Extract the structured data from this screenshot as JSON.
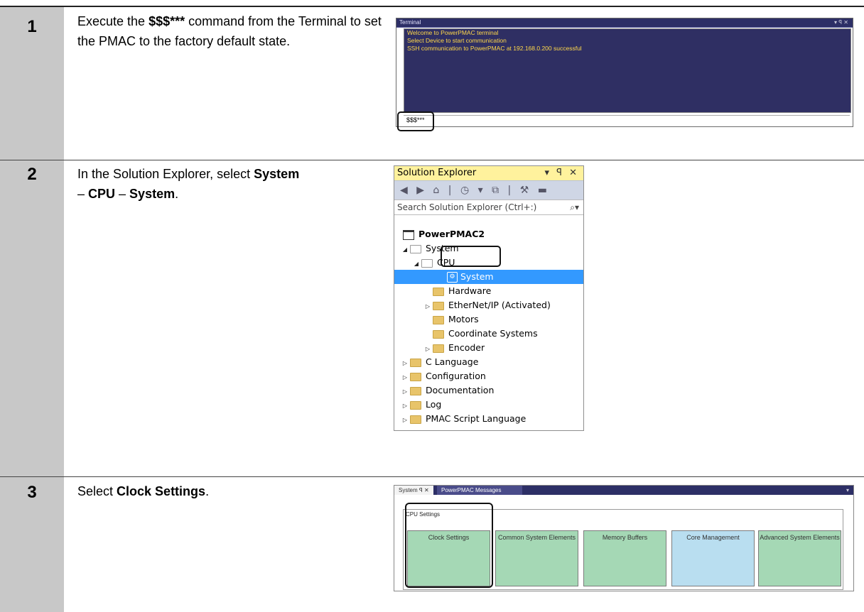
{
  "steps": [
    {
      "number": "1",
      "text_pre": "Execute the ",
      "bold1": "$$$***",
      "text_post": " command from the Terminal to set the PMAC to the factory default state."
    },
    {
      "number": "2",
      "text_pre": "In the Solution Explorer, select ",
      "bold1": "System",
      "sep1": " – ",
      "bold2": "CPU",
      "sep2": " – ",
      "bold3": "System",
      "end": "."
    },
    {
      "number": "3",
      "text_pre": "Select ",
      "bold1": "Clock Settings",
      "end": "."
    }
  ],
  "terminal": {
    "title": "Terminal",
    "window_controls": "▾ ꟼ ✕",
    "lines": [
      "Welcome to PowerPMAC terminal",
      "Select Device to start communication",
      "SSH communication to PowerPMAC at 192.168.0.200 successful"
    ],
    "input_value": "$$$***"
  },
  "solution_explorer": {
    "title": "Solution Explorer",
    "window_controls": "▾ ꟼ ✕",
    "toolbar": "◀ ▶ ⌂ | ◷ ▾ ⧉ | ⚒ ▬",
    "search_placeholder": "Search Solution Explorer (Ctrl+:)",
    "nodes": [
      {
        "label": "PowerPMAC2"
      },
      {
        "label": "System"
      },
      {
        "label": "CPU"
      },
      {
        "label": "System"
      },
      {
        "label": "Hardware"
      },
      {
        "label": "EtherNet/IP (Activated)"
      },
      {
        "label": "Motors"
      },
      {
        "label": "Coordinate Systems"
      },
      {
        "label": "Encoder"
      },
      {
        "label": "C Language"
      },
      {
        "label": "Configuration"
      },
      {
        "label": "Documentation"
      },
      {
        "label": "Log"
      },
      {
        "label": "PMAC Script Language"
      }
    ]
  },
  "system_panel": {
    "tab_active": "System  ꟼ ✕",
    "tab_other": "PowerPMAC Messages",
    "group_label": "CPU Settings",
    "tiles": [
      {
        "label": "Clock Settings",
        "color": "#a5d8b5"
      },
      {
        "label": "Common System Elements",
        "color": "#a5d8b5"
      },
      {
        "label": "Memory Buffers",
        "color": "#a5d8b5"
      },
      {
        "label": "Core Management",
        "color": "#b9def0"
      },
      {
        "label": "Advanced System Elements",
        "color": "#a5d8b5"
      }
    ]
  }
}
